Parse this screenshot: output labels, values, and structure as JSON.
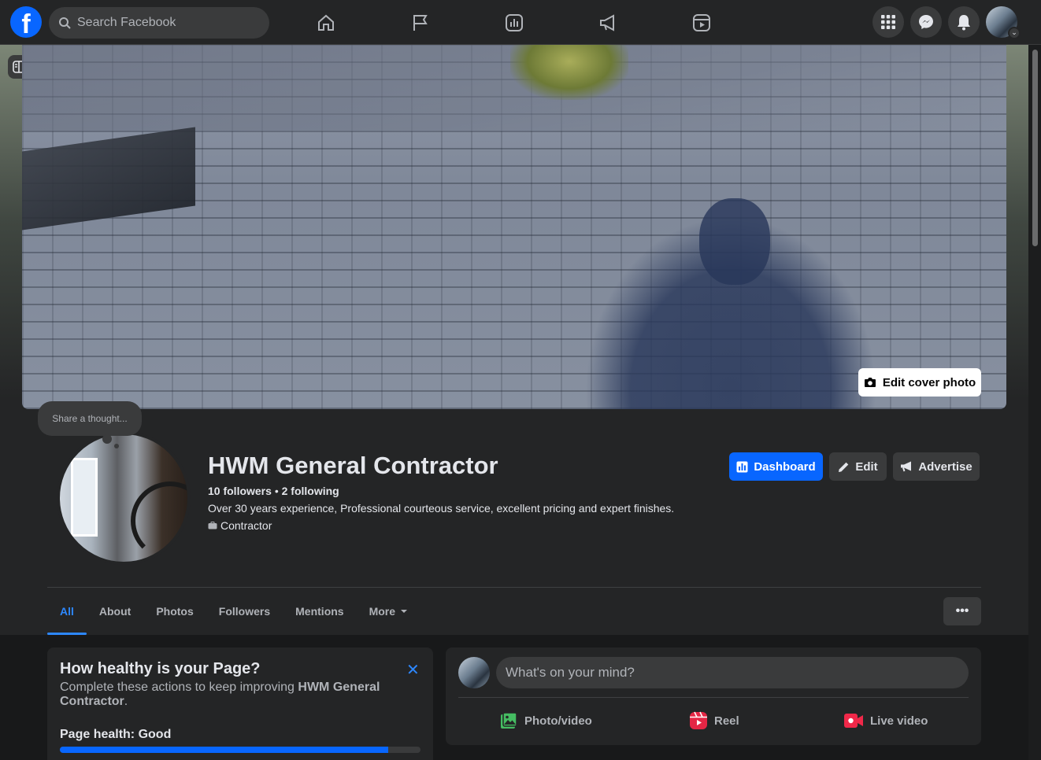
{
  "topbar": {
    "logo": "f",
    "search_placeholder": "Search Facebook",
    "nav_icons": [
      "home-icon",
      "flag-icon",
      "insights-icon",
      "megaphone-icon",
      "reels-icon"
    ],
    "right_icons": [
      "menu-grid-icon",
      "messenger-icon",
      "bell-icon"
    ]
  },
  "cover": {
    "edit_label": "Edit cover photo"
  },
  "profile": {
    "thought": "Share a thought...",
    "name": "HWM General Contractor",
    "followers_count": "10 followers",
    "separator": "•",
    "following_count": "2 following",
    "bio": "Over 30 years experience, Professional courteous service, excellent pricing and expert finishes.",
    "category": "Contractor"
  },
  "header_buttons": {
    "dashboard": "Dashboard",
    "edit": "Edit",
    "advertise": "Advertise"
  },
  "tabs": [
    {
      "label": "All",
      "active": true
    },
    {
      "label": "About"
    },
    {
      "label": "Photos"
    },
    {
      "label": "Followers"
    },
    {
      "label": "Mentions"
    },
    {
      "label": "More"
    }
  ],
  "more_button": "•••",
  "health": {
    "title": "How healthy is your Page?",
    "desc_prefix": "Complete these actions to keep improving ",
    "desc_name": "HWM General Contractor",
    "desc_suffix": ".",
    "label": "Page health: Good",
    "close": "✕",
    "progress": 0.91
  },
  "composer": {
    "placeholder": "What's on your mind?",
    "actions": {
      "photo": "Photo/video",
      "reel": "Reel",
      "live": "Live video"
    }
  },
  "colors": {
    "accent": "#0866ff",
    "link": "#2d88ff",
    "photo_icon": "#45bd62",
    "reel_icon": "#e42645",
    "live_icon": "#f02849"
  }
}
